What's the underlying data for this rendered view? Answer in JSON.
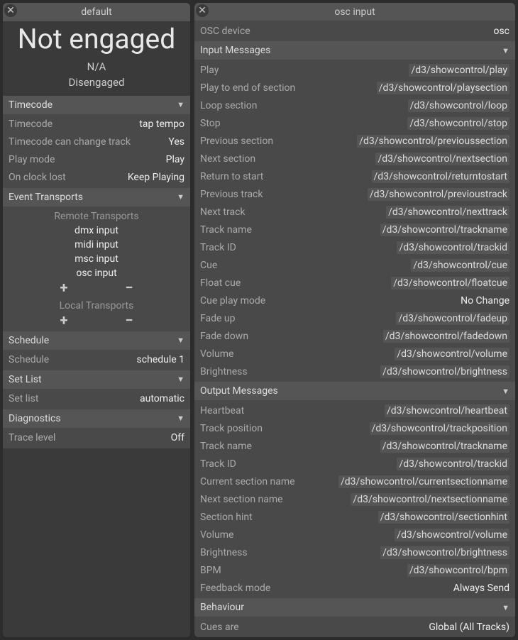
{
  "left": {
    "title": "default",
    "status_big": "Not engaged",
    "status_sub": "N/A",
    "status_sub2": "Disengaged",
    "timecode": {
      "header": "Timecode",
      "rows": [
        {
          "label": "Timecode",
          "value": "tap tempo"
        },
        {
          "label": "Timecode can change track",
          "value": "Yes"
        },
        {
          "label": "Play mode",
          "value": "Play"
        },
        {
          "label": "On clock lost",
          "value": "Keep Playing"
        }
      ]
    },
    "event_transports": {
      "header": "Event Transports",
      "remote_header": "Remote Transports",
      "remote_items": [
        "dmx input",
        "midi input",
        "msc input",
        "osc input"
      ],
      "local_header": "Local Transports"
    },
    "schedule": {
      "header": "Schedule",
      "rows": [
        {
          "label": "Schedule",
          "value": "schedule 1"
        }
      ]
    },
    "setlist": {
      "header": "Set List",
      "rows": [
        {
          "label": "Set list",
          "value": "automatic"
        }
      ]
    },
    "diagnostics": {
      "header": "Diagnostics",
      "rows": [
        {
          "label": "Trace level",
          "value": "Off"
        }
      ]
    }
  },
  "right": {
    "title": "osc input",
    "device": {
      "label": "OSC device",
      "value": "osc"
    },
    "input_messages": {
      "header": "Input Messages",
      "rows": [
        {
          "label": "Play",
          "value": "/d3/showcontrol/play",
          "box": true
        },
        {
          "label": "Play to end of section",
          "value": "/d3/showcontrol/playsection",
          "box": true
        },
        {
          "label": "Loop section",
          "value": "/d3/showcontrol/loop",
          "box": true
        },
        {
          "label": "Stop",
          "value": "/d3/showcontrol/stop",
          "box": true
        },
        {
          "label": "Previous section",
          "value": "/d3/showcontrol/previoussection",
          "box": true
        },
        {
          "label": "Next section",
          "value": "/d3/showcontrol/nextsection",
          "box": true
        },
        {
          "label": "Return to start",
          "value": "/d3/showcontrol/returntostart",
          "box": true
        },
        {
          "label": "Previous track",
          "value": "/d3/showcontrol/previoustrack",
          "box": true
        },
        {
          "label": "Next track",
          "value": "/d3/showcontrol/nexttrack",
          "box": true
        },
        {
          "label": "Track name",
          "value": "/d3/showcontrol/trackname",
          "box": true
        },
        {
          "label": "Track ID",
          "value": "/d3/showcontrol/trackid",
          "box": true
        },
        {
          "label": "Cue",
          "value": "/d3/showcontrol/cue",
          "box": true
        },
        {
          "label": "Float cue",
          "value": "/d3/showcontrol/floatcue",
          "box": true
        },
        {
          "label": "Cue play mode",
          "value": "No Change",
          "box": false
        },
        {
          "label": "Fade up",
          "value": "/d3/showcontrol/fadeup",
          "box": true
        },
        {
          "label": "Fade down",
          "value": "/d3/showcontrol/fadedown",
          "box": true
        },
        {
          "label": "Volume",
          "value": "/d3/showcontrol/volume",
          "box": true
        },
        {
          "label": "Brightness",
          "value": "/d3/showcontrol/brightness",
          "box": true
        }
      ]
    },
    "output_messages": {
      "header": "Output Messages",
      "rows": [
        {
          "label": "Heartbeat",
          "value": "/d3/showcontrol/heartbeat",
          "box": true
        },
        {
          "label": "Track position",
          "value": "/d3/showcontrol/trackposition",
          "box": true
        },
        {
          "label": "Track name",
          "value": "/d3/showcontrol/trackname",
          "box": true
        },
        {
          "label": "Track ID",
          "value": "/d3/showcontrol/trackid",
          "box": true
        },
        {
          "label": "Current section name",
          "value": "/d3/showcontrol/currentsectionname",
          "box": true
        },
        {
          "label": "Next section name",
          "value": "/d3/showcontrol/nextsectionname",
          "box": true
        },
        {
          "label": "Section hint",
          "value": "/d3/showcontrol/sectionhint",
          "box": true
        },
        {
          "label": "Volume",
          "value": "/d3/showcontrol/volume",
          "box": true
        },
        {
          "label": "Brightness",
          "value": "/d3/showcontrol/brightness",
          "box": true
        },
        {
          "label": "BPM",
          "value": "/d3/showcontrol/bpm",
          "box": true
        },
        {
          "label": "Feedback mode",
          "value": "Always Send",
          "box": false
        }
      ]
    },
    "behaviour": {
      "header": "Behaviour",
      "rows": [
        {
          "label": "Cues are",
          "value": "Global (All Tracks)",
          "box": false
        }
      ]
    }
  }
}
